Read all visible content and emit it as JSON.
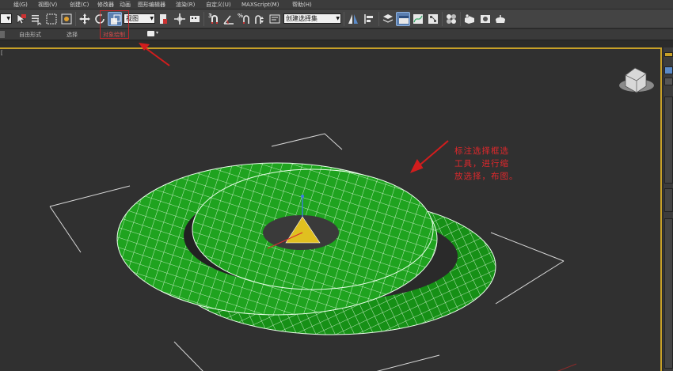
{
  "menu": {
    "items": [
      "组(G)",
      "视图(V)",
      "创建(C)",
      "修改器",
      "动画",
      "图形编辑器",
      "渲染(R)",
      "自定义(U)",
      "MAXScript(M)",
      "帮助(H)"
    ]
  },
  "toolbar": {
    "selection_filter": "",
    "ref_coord": "视图",
    "named_selection": "创建选择集",
    "snap_labels": [
      "3",
      "%"
    ],
    "icons": [
      "select-object-icon",
      "select-by-name-icon",
      "rect-select-icon",
      "window-crossing-icon",
      "move-icon",
      "rotate-icon",
      "scale-icon",
      "pivot-icon",
      "manipulate-icon",
      "snap-toggle-icon",
      "angle-snap-icon",
      "percent-snap-icon",
      "spinner-snap-icon",
      "edit-named-selection-icon",
      "mirror-icon",
      "align-icon",
      "layer-manager-icon",
      "graphite-toggle-icon",
      "curve-editor-icon",
      "schematic-view-icon",
      "material-editor-icon",
      "render-setup-icon",
      "rendered-frame-icon",
      "render-icon"
    ]
  },
  "ribbon": {
    "tabs": [
      "自由形式",
      "选择",
      "对象绘制"
    ],
    "active_index": 2
  },
  "viewport": {
    "label": "[",
    "annotation": "标注选择框选\n工具，进行缩\n放选择，布图。"
  },
  "colors": {
    "accent_border": "#c7a028",
    "object_fill": "#1fa31f",
    "wire": "#ffffff",
    "annotation": "#e0282c"
  }
}
